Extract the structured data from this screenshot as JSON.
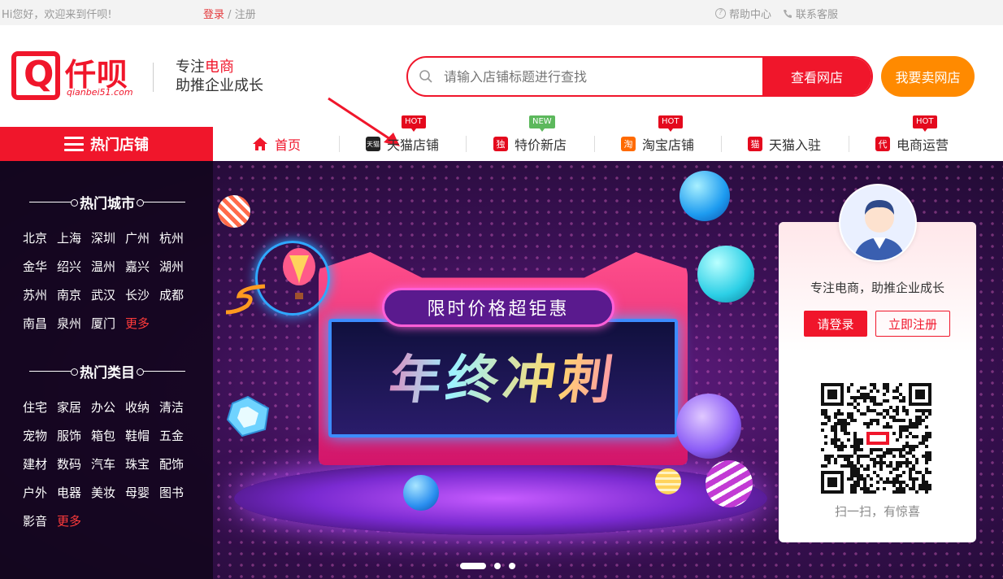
{
  "topbar": {
    "welcome": "Hi您好，欢迎来到仟呗!",
    "login": "登录",
    "sep": "/",
    "register": "注册",
    "help": "帮助中心",
    "service": "联系客服"
  },
  "header": {
    "logo_text": "仟呗",
    "logo_url": "qianbei51.com",
    "slogan_prefix": "专注",
    "slogan_highlight": "电商",
    "slogan_line2": "助推企业成长",
    "search_placeholder": "请输入店铺标题进行查找",
    "search_button": "查看网店",
    "sell_button": "我要卖网店"
  },
  "nav": {
    "hot_category": "热门店铺",
    "items": [
      {
        "label": "首页",
        "icon": "home-icon",
        "tag": ""
      },
      {
        "label": "天猫店铺",
        "icon": "tmall-icon",
        "icon_text": "天猫",
        "tag": "HOT"
      },
      {
        "label": "特价新店",
        "icon": "du-icon",
        "icon_text": "独",
        "tag": "NEW"
      },
      {
        "label": "淘宝店铺",
        "icon": "taobao-icon",
        "icon_text": "淘",
        "tag": "HOT"
      },
      {
        "label": "天猫入驻",
        "icon": "mao-icon",
        "icon_text": "猫",
        "tag": ""
      },
      {
        "label": "电商运营",
        "icon": "dai-icon",
        "icon_text": "代",
        "tag": "HOT"
      }
    ]
  },
  "sidebar": {
    "cities_title": "热门城市",
    "cities": [
      "北京",
      "上海",
      "深圳",
      "广州",
      "杭州",
      "金华",
      "绍兴",
      "温州",
      "嘉兴",
      "湖州",
      "苏州",
      "南京",
      "武汉",
      "长沙",
      "成都",
      "南昌",
      "泉州",
      "厦门",
      "更多"
    ],
    "categories_title": "热门类目",
    "categories": [
      "住宅",
      "家居",
      "办公",
      "收纳",
      "清洁",
      "宠物",
      "服饰",
      "箱包",
      "鞋帽",
      "五金",
      "建材",
      "数码",
      "汽车",
      "珠宝",
      "配饰",
      "户外",
      "电器",
      "美妆",
      "母婴",
      "图书",
      "影音",
      "更多"
    ]
  },
  "banner": {
    "subtitle": "限时价格超钜惠",
    "title": "年终冲刺",
    "slides": 3,
    "active_slide": 1
  },
  "login_card": {
    "slogan": "专注电商，助推企业成长",
    "login_button": "请登录",
    "register_button": "立即注册",
    "scan_text": "扫一扫，有惊喜"
  },
  "colors": {
    "brand_red": "#f0162b",
    "sell_orange": "#ff8a00",
    "hot_tag": "#e4091d",
    "new_tag": "#5cb85c"
  }
}
